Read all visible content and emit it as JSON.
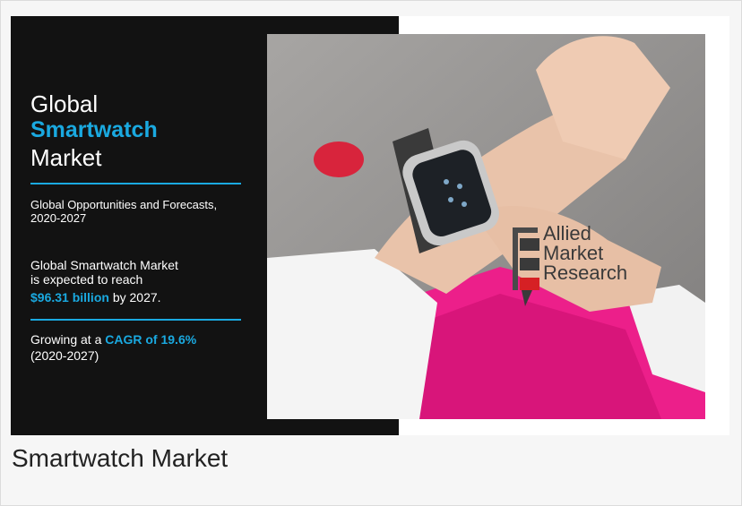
{
  "banner": {
    "title_line1": "Global",
    "title_line2": "Smartwatch",
    "title_line3": "Market",
    "subtitle_line1": "Global Opportunities and Forecasts,",
    "subtitle_line2": "2020-2027",
    "reach_line1": "Global Smartwatch Market",
    "reach_line2": "is expected to reach",
    "reach_value": "$96.31 billion",
    "reach_suffix": "by 2027.",
    "growth_prefix": "Growing at a",
    "growth_value": "CAGR of 19.6%",
    "growth_years": "(2020-2027)",
    "logo_words": [
      "Allied",
      "Market",
      "Research"
    ]
  },
  "caption": "Smartwatch Market",
  "colors": {
    "accent": "#1aa9e0",
    "panel": "#121212",
    "pink": "#f0208c"
  }
}
